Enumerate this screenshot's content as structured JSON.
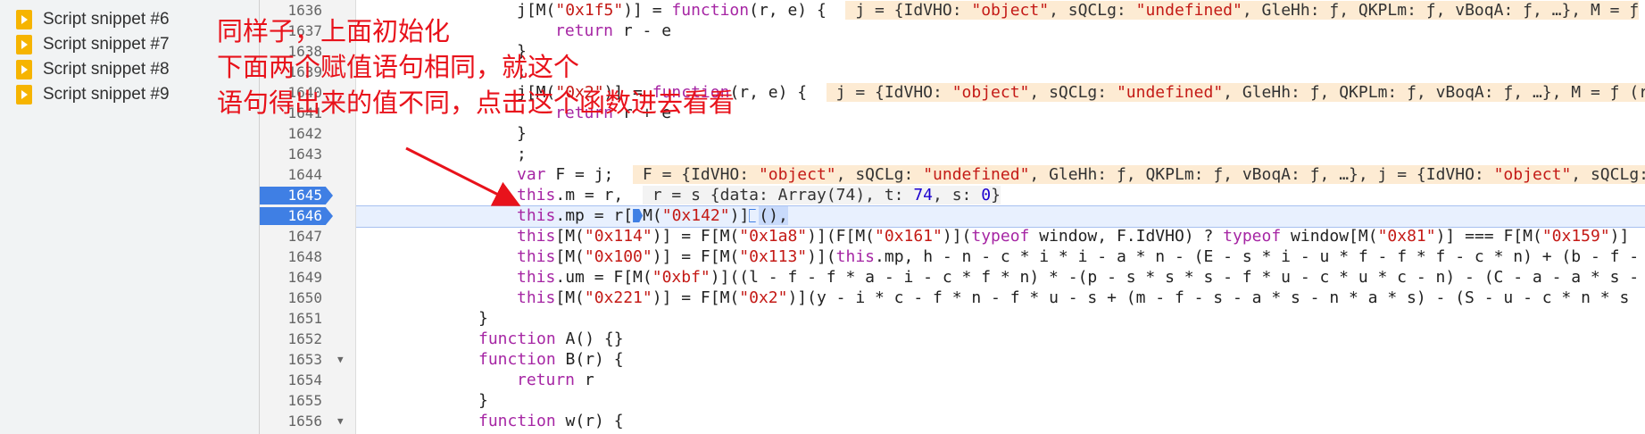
{
  "sidebar": {
    "items": [
      {
        "label": "Script snippet #6",
        "icon": "script-snippet-icon"
      },
      {
        "label": "Script snippet #7",
        "icon": "script-snippet-icon"
      },
      {
        "label": "Script snippet #8",
        "icon": "script-snippet-icon"
      },
      {
        "label": "Script snippet #9",
        "icon": "script-snippet-icon"
      }
    ]
  },
  "gutter": {
    "line_numbers": [
      "1636",
      "1637",
      "1638",
      "1639",
      "1640",
      "1641",
      "1642",
      "1643",
      "1644",
      "1645",
      "1646",
      "1647",
      "1648",
      "1649",
      "1650",
      "1651",
      "1652",
      "1653",
      "1654",
      "1655",
      "1656"
    ],
    "breakpoint_lines": [
      "1645",
      "1646"
    ],
    "fold_lines": [
      "1653",
      "1656"
    ]
  },
  "code": {
    "l1636_a": "j[M(",
    "l1636_s": "\"0x1f5\"",
    "l1636_b": ")] = ",
    "l1636_k": "function",
    "l1636_c": "(r, e) {  ",
    "l1636_i1": " j = {IdVHO: ",
    "l1636_i2": "\"object\"",
    "l1636_i3": ", sQCLg: ",
    "l1636_i4": "\"undefined\"",
    "l1636_i5": ", GleHh: ƒ, QKPLm: ƒ, vBoqA: ƒ, …}, M = ƒ",
    "l1637_k": "return",
    "l1637_c": " r - e",
    "l1638": "}",
    "l1639": ";",
    "l1640_a": "j[M(",
    "l1640_s": "\"0x2\"",
    "l1640_b": ")] = ",
    "l1640_k": "function",
    "l1640_c": "(r, e) {  ",
    "l1640_i1": " j = {IdVHO: ",
    "l1640_i2": "\"object\"",
    "l1640_i3": ", sQCLg: ",
    "l1640_i4": "\"undefined\"",
    "l1640_i5": ", GleHh: ƒ, QKPLm: ƒ, vBoqA: ƒ, …}, M = ƒ (r",
    "l1641_k": "return",
    "l1641_c": " r + e",
    "l1642": "}",
    "l1643": ";",
    "l1644_k": "var",
    "l1644_c": " F = j;  ",
    "l1644_i1": " F = {IdVHO: ",
    "l1644_i2": "\"object\"",
    "l1644_i3": ", sQCLg: ",
    "l1644_i4": "\"undefined\"",
    "l1644_i5": ", GleHh: ƒ, QKPLm: ƒ, vBoqA: ƒ, …}, j = {IdVHO: ",
    "l1644_i6": "\"object\"",
    "l1644_i7": ", sQCLg:",
    "l1645_k": "this",
    "l1645_c": ".m = r,  ",
    "l1645_i1": " r = s {data: Array(74), t: ",
    "l1645_i2": "74",
    "l1645_i3": ", s: ",
    "l1645_i4": "0",
    "l1645_i5": "}",
    "l1646_k": "this",
    "l1646_a": ".mp = r[",
    "l1646_b": "M(",
    "l1646_s": "\"0x142\"",
    "l1646_c": ")]",
    "l1646_d": "(),",
    "l1647_k": "this",
    "l1647_a": "[M(",
    "l1647_s1": "\"0x114\"",
    "l1647_b": ")] = F[M(",
    "l1647_s2": "\"0x1a8\"",
    "l1647_c": ")](F[M(",
    "l1647_s3": "\"0x161\"",
    "l1647_d": ")](",
    "l1647_k2": "typeof",
    "l1647_e": " window, F.IdVHO) ? ",
    "l1647_k3": "typeof",
    "l1647_f": " window[M(",
    "l1647_s4": "\"0x81\"",
    "l1647_g": ")] === F[M(",
    "l1647_s5": "\"0x159\"",
    "l1647_h": ")]",
    "l1648_k": "this",
    "l1648_a": "[M(",
    "l1648_s1": "\"0x100\"",
    "l1648_b": ")] = F[M(",
    "l1648_s2": "\"0x113\"",
    "l1648_c": ")](",
    "l1648_k2": "this",
    "l1648_d": ".mp, h - n - c * i * i - a * n - (E - s * i - u * f - f * f - c * n) + (b - f -",
    "l1649_k": "this",
    "l1649_a": ".um = F[M(",
    "l1649_s": "\"0xbf\"",
    "l1649_b": ")]((l - f - f * a - i - c * f * n) * -(p - s * s * s - f * u - c * u * c - n) - (C - a - a * s -",
    "l1650_k": "this",
    "l1650_a": "[M(",
    "l1650_s1": "\"0x221\"",
    "l1650_b": ")] = F[M(",
    "l1650_s2": "\"0x2\"",
    "l1650_c": ")](y - i * c - f * n - f * u - s + (m - f - s - a * s - n * a * s) - (S - u - c * n * s",
    "l1651": "}",
    "l1652_k": "function",
    "l1652_c": " A() {}",
    "l1653_k": "function",
    "l1653_c": " B(r) {",
    "l1654_k": "return",
    "l1654_c": " r",
    "l1655": "}",
    "l1656_k": "function",
    "l1656_c": " w(r) {"
  },
  "annotation": {
    "line1": "同样子，上面初始化",
    "line2": "下面两个赋值语句相同，就这个",
    "line3": "语句得出来的值不同，点击这个函数进去看看"
  },
  "colors": {
    "annotation": "#e8121b",
    "breakpoint": "#3f7fe4",
    "keyword": "#a626a4",
    "string": "#c41a16",
    "inline_value_bg": "#fdebd3"
  }
}
